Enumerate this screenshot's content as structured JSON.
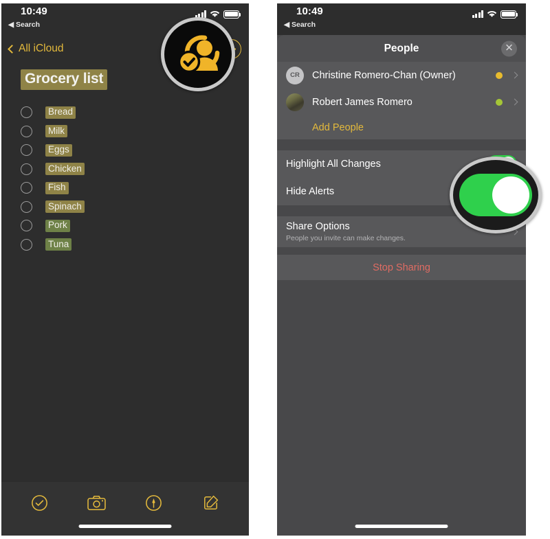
{
  "left_panel": {
    "status_bar": {
      "time": "10:49",
      "location_icon": "location-arrow-icon",
      "back_label": "Search",
      "cellular_icon": "cellular-bars-icon",
      "wifi_icon": "wifi-icon",
      "battery_icon": "battery-icon"
    },
    "nav": {
      "back_label": "All iCloud",
      "back_chevron_icon": "chevron-left-icon",
      "more_button_icon": "ellipsis-circle-icon",
      "accent_color": "#e3b93c"
    },
    "note": {
      "title": "Grocery list",
      "title_highlight_color": "#8f8347",
      "items": [
        {
          "label": "Bread",
          "checked": false,
          "highlight": "olive"
        },
        {
          "label": "Milk",
          "checked": false,
          "highlight": "olive"
        },
        {
          "label": "Eggs",
          "checked": false,
          "highlight": "olive"
        },
        {
          "label": "Chicken",
          "checked": false,
          "highlight": "olive"
        },
        {
          "label": "Fish",
          "checked": false,
          "highlight": "olive"
        },
        {
          "label": "Spinach",
          "checked": false,
          "highlight": "olive"
        },
        {
          "label": "Pork",
          "checked": false,
          "highlight": "green"
        },
        {
          "label": "Tuna",
          "checked": false,
          "highlight": "green"
        }
      ],
      "highlight_colors": {
        "olive": "#8f8347",
        "green": "#6e8147"
      }
    },
    "toolbar": {
      "buttons": [
        {
          "icon": "checkmark-circle-icon"
        },
        {
          "icon": "camera-icon"
        },
        {
          "icon": "markup-pen-circle-icon"
        },
        {
          "icon": "compose-icon"
        }
      ]
    },
    "magnifier": {
      "icon": "share-person-checkmark-icon",
      "ring_color": "#c9c9c9",
      "background_color": "#0a0a0a",
      "icon_color": "#f0b429"
    }
  },
  "right_panel": {
    "status_bar": {
      "time": "10:49",
      "location_icon": "location-arrow-icon",
      "back_label": "Search",
      "cellular_icon": "cellular-bars-icon",
      "wifi_icon": "wifi-icon",
      "battery_icon": "battery-icon"
    },
    "sheet": {
      "title": "People",
      "close_icon": "close-icon",
      "people": [
        {
          "name": "Christine Romero-Chan (Owner)",
          "avatar_type": "initials",
          "initials": "CR",
          "dot_color": "#e8bb2e",
          "chevron_icon": "chevron-right-icon"
        },
        {
          "name": "Robert James Romero",
          "avatar_type": "photo",
          "initials": "",
          "dot_color": "#a5c637",
          "chevron_icon": "chevron-right-icon"
        }
      ],
      "add_people_label": "Add People",
      "settings": [
        {
          "label": "Highlight All Changes",
          "control": "toggle",
          "value": "on"
        },
        {
          "label": "Hide Alerts",
          "control": "toggle",
          "value": "off"
        }
      ],
      "share_options": {
        "label": "Share Options",
        "subtitle": "People you invite can make changes.",
        "chevron_icon": "chevron-right-icon"
      },
      "stop_sharing_label": "Stop Sharing",
      "stop_sharing_color": "#e06c63"
    },
    "magnifier": {
      "control": "toggle-switch",
      "state": "on",
      "ring_color": "#c9c9c9",
      "track_color": "#2fd04c",
      "knob_color": "#ffffff"
    }
  }
}
